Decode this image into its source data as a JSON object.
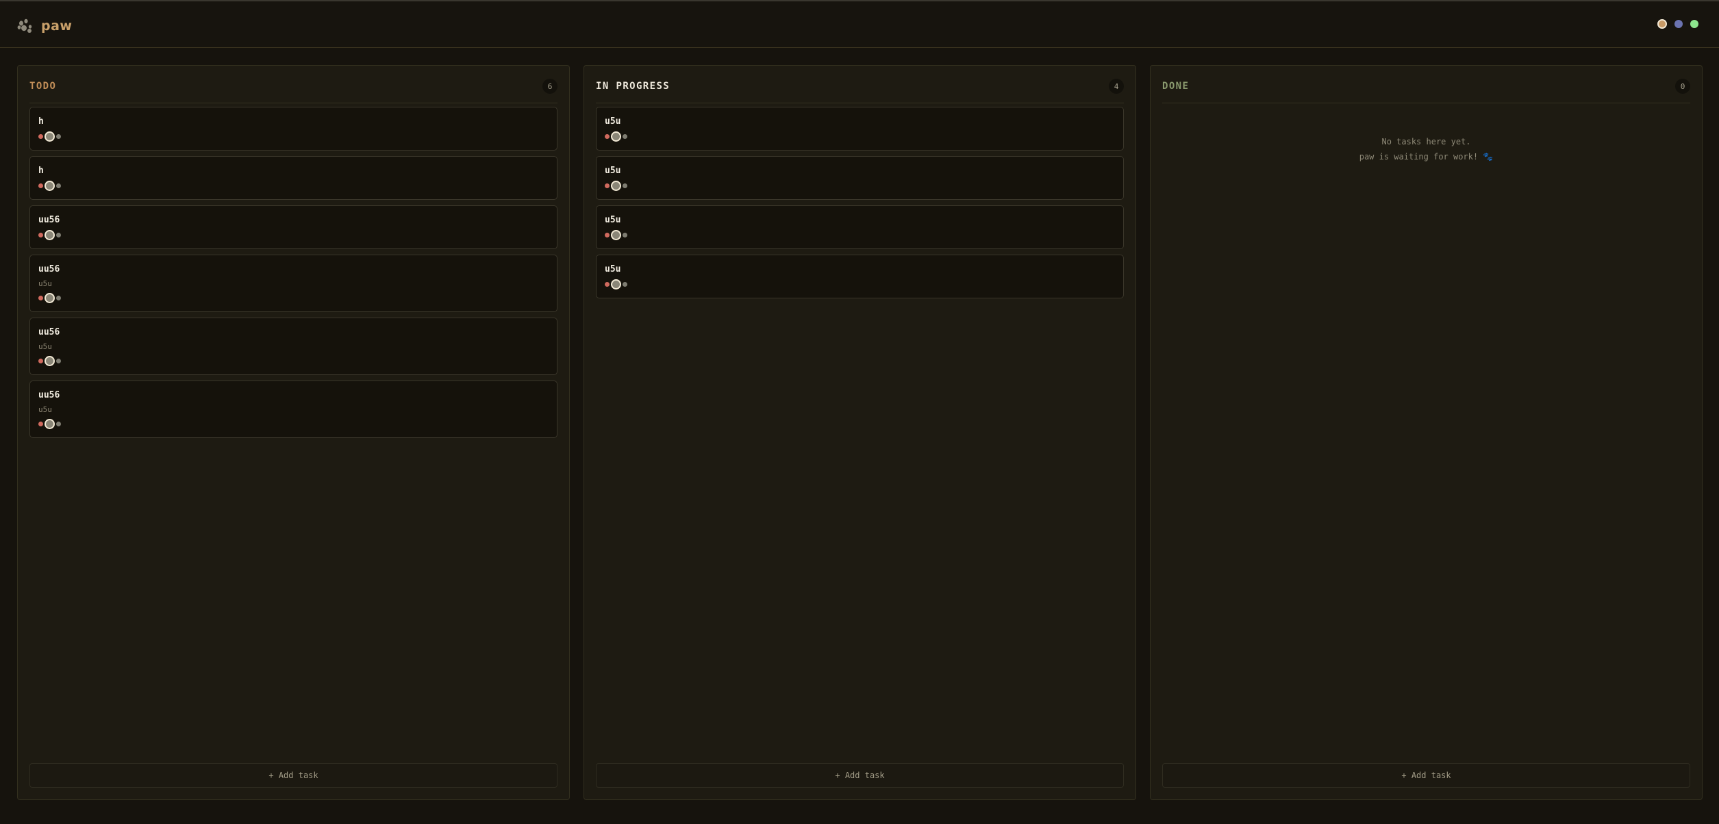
{
  "app": {
    "title": "paw",
    "logo_icon": "paw-icon"
  },
  "theme_switcher": {
    "options": [
      {
        "name": "theme-amber",
        "color": "#c89a66",
        "active": true
      },
      {
        "name": "theme-blue",
        "color": "#6b73b0",
        "active": false
      },
      {
        "name": "theme-green",
        "color": "#8ee68e",
        "active": false
      }
    ]
  },
  "priority_colors": [
    "#d06a5e",
    "#a19e8e",
    "#7f7d72"
  ],
  "columns": [
    {
      "id": "todo",
      "title": "TODO",
      "title_color": "#c38f58",
      "count": "6",
      "add_label": "+ Add task",
      "cards": [
        {
          "title": "h",
          "description": ""
        },
        {
          "title": "h",
          "description": ""
        },
        {
          "title": "uu56",
          "description": ""
        },
        {
          "title": "uu56",
          "description": "u5u"
        },
        {
          "title": "uu56",
          "description": "u5u"
        },
        {
          "title": "uu56",
          "description": "u5u"
        }
      ]
    },
    {
      "id": "in-progress",
      "title": "IN PROGRESS",
      "title_color": "#efe9dc",
      "count": "4",
      "add_label": "+ Add task",
      "cards": [
        {
          "title": "u5u",
          "description": ""
        },
        {
          "title": "u5u",
          "description": ""
        },
        {
          "title": "u5u",
          "description": ""
        },
        {
          "title": "u5u",
          "description": ""
        }
      ]
    },
    {
      "id": "done",
      "title": "DONE",
      "title_color": "#8a9a6e",
      "count": "0",
      "add_label": "+ Add task",
      "cards": [],
      "empty_line1": "No tasks here yet.",
      "empty_line2": "paw is waiting for work! 🐾"
    }
  ]
}
